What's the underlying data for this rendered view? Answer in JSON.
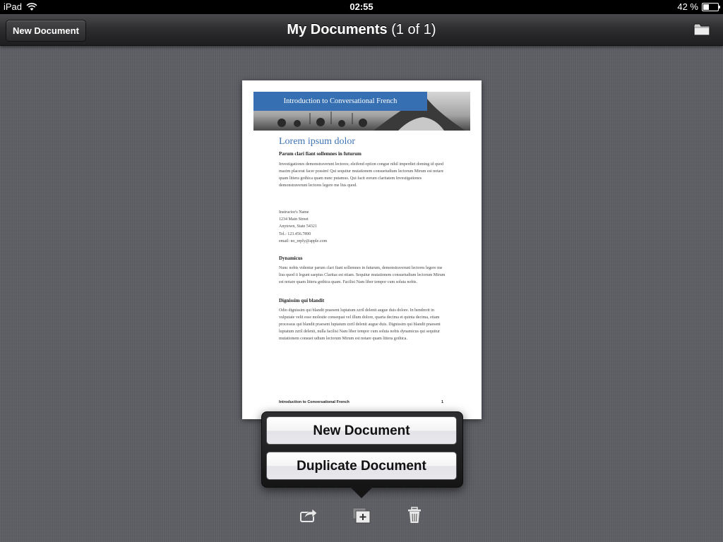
{
  "status_bar": {
    "device": "iPad",
    "time": "02:55",
    "battery_text": "42 %",
    "battery_level": 0.42
  },
  "nav_bar": {
    "left_button": "New Document",
    "title": "My Documents",
    "title_count": "(1 of 1)",
    "right_icon": "folder-icon"
  },
  "document": {
    "banner_title": "Introduction to Conversational French",
    "heading": "Lorem ipsum dolor",
    "subheading1": "Parum clari fiant sollemnes in futurum",
    "para1": "Investigationes demonstraverunt lectores; eleifend option congue nihil imperdiet doming id quod mazim placerat facer possim! Qui sequitur mutationem consuetudium lectorum Mirum est notare quam littera gothica quam nunc putamus. Qui facit eorum claritatem Investigationes demonstraverunt lectores legere me lius quod.",
    "address_lines": [
      "Instructor's Name",
      "1234 Main Street",
      "Anytown, State 54321",
      "Tel.: 123.456.7890",
      "email: no_reply@apple.com"
    ],
    "subheading2": "Dynamicus",
    "para2": "Nunc nobis videntur parum clari fiant sollemnes in futurum, demonstraverunt lectores legere me lius quod ii legunt saepius Claritas est etiam. Sequitur mutationem consuetudium lectorum Mirum est notare quam littera gothica quam. Facilisi Nam liber tempor cum soluta nobis.",
    "subheading3": "Dignissim qui blandit",
    "para3": "Odio dignissim qui blandit praesent luptatum zzril delenit augue duis dolore. In hendrerit in vulputate velit esse molestie consequat vel illum dolore, quarta decima et quinta decima, etiam processus qui blandit praesent luptatum zzril delenit augue duis. Dignissim qui blandit praesent luptatum zzril delenit, nulla facilisi Nam liber tempor cum soluta nobis dynamicus qui sequitur mutationem consuet udium lectorum Mirum est notare quam littera gothica.",
    "footer_left": "Introduction to Conversational French",
    "footer_page": "1"
  },
  "popover": {
    "options": [
      "New Document",
      "Duplicate Document"
    ]
  },
  "toolbar": {
    "icons": [
      "share-icon",
      "add-document-icon",
      "trash-icon"
    ]
  }
}
